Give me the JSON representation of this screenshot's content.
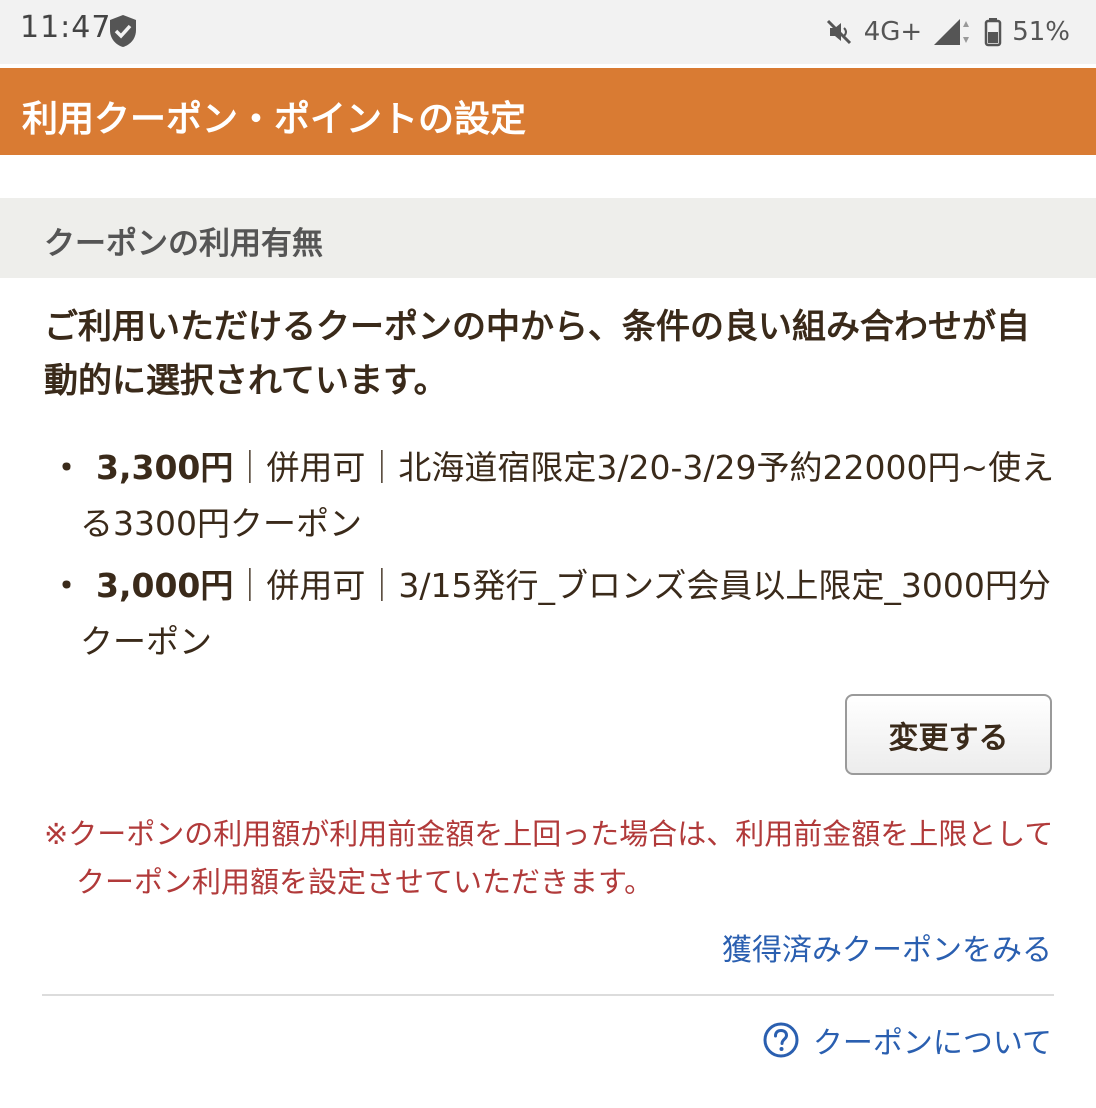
{
  "status_bar": {
    "time": "11:47",
    "network": "4G+",
    "battery": "51%",
    "icons": [
      "shield-icon",
      "mute-icon",
      "signal-icon",
      "battery-icon"
    ]
  },
  "header": {
    "title": "利用クーポン・ポイントの設定",
    "color": "#d97b33"
  },
  "coupon_section": {
    "heading": "クーポンの利用有無",
    "description": "ご利用いただけるクーポンの中から、条件の良い組み合わせが自動的に選択されています。",
    "coupons": [
      {
        "amount": "3,300円",
        "details": "｜併用可｜北海道宿限定3/20-3/29予約22000円~使える3300円クーポン"
      },
      {
        "amount": "3,000円",
        "details": "｜併用可｜3/15発行_ブロンズ会員以上限定_3000円分クーポン"
      }
    ],
    "change_button": "変更する",
    "note": "※クーポンの利用額が利用前金額を上回った場合は、利用前金額を上限としてクーポン利用額を設定させていただきます。",
    "acquired_link": "獲得済みクーポンをみる",
    "about_link": "クーポンについて",
    "link_color": "#2a5fb0",
    "note_color": "#b13a3a"
  }
}
